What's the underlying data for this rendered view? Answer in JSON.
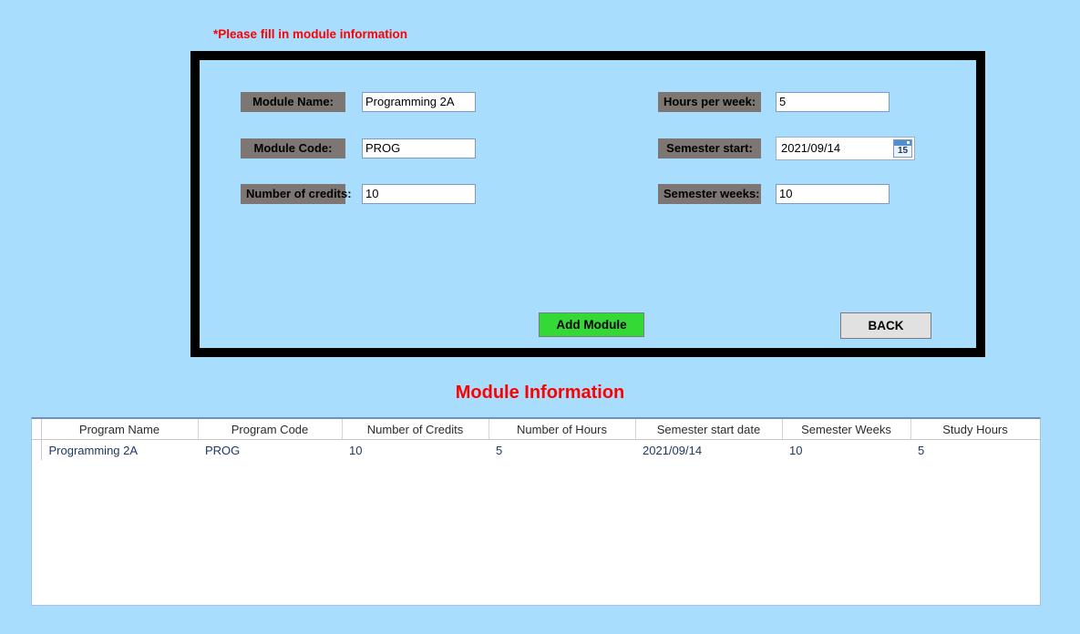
{
  "instruction": "*Please fill in module information",
  "form": {
    "left_fields": [
      {
        "label": "Module Name:",
        "value": "Programming 2A",
        "name": "module-name"
      },
      {
        "label": "Module Code:",
        "value": "PROG",
        "name": "module-code"
      },
      {
        "label": "Number of credits:",
        "value": "10",
        "name": "number-of-credits"
      }
    ],
    "right_fields": [
      {
        "label": "Hours per week:",
        "value": "5",
        "name": "hours-per-week"
      },
      {
        "label": "Semester start:",
        "value": "2021/09/14",
        "name": "semester-start"
      },
      {
        "label": "Semester weeks:",
        "value": "10",
        "name": "semester-weeks"
      }
    ],
    "calendar_icon_day": "15",
    "add_button": "Add Module",
    "back_button": "BACK"
  },
  "grid": {
    "title": "Module Information",
    "columns": [
      "Program Name",
      "Program Code",
      "Number of Credits",
      "Number of Hours",
      "Semester start date",
      "Semester Weeks",
      "Study Hours"
    ],
    "rows": [
      {
        "program_name": "Programming 2A",
        "program_code": "PROG",
        "number_of_credits": "10",
        "number_of_hours": "5",
        "semester_start_date": "2021/09/14",
        "semester_weeks": "10",
        "study_hours": "5"
      }
    ]
  },
  "colors": {
    "page_background": "#a9ddfd",
    "label_background": "#7d7672",
    "accent_red": "#ff0000",
    "add_button_green": "#35d935",
    "back_button_gray": "#e1e1e1",
    "grid_text": "#1f3864"
  }
}
